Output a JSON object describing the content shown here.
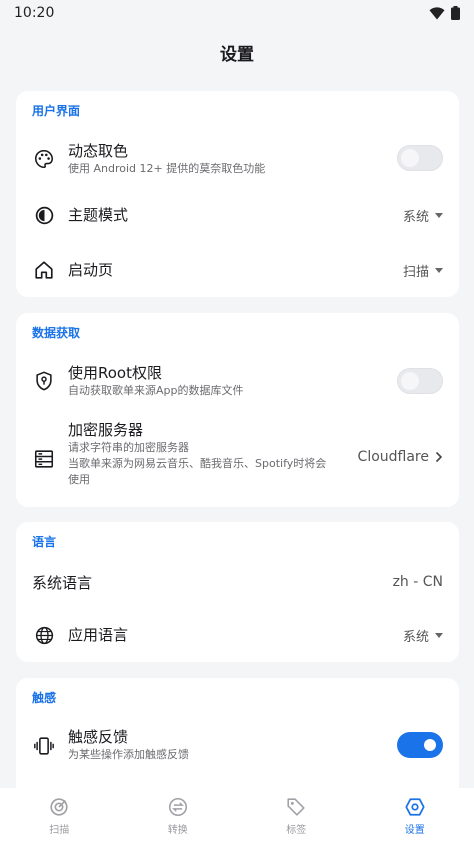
{
  "status_bar": {
    "time": "10:20"
  },
  "header": {
    "title": "设置"
  },
  "sections": {
    "ui": {
      "header": "用户界面",
      "dynamic_color": {
        "title": "动态取色",
        "subtitle": "使用 Android 12+ 提供的莫奈取色功能",
        "enabled": false
      },
      "theme_mode": {
        "title": "主题模式",
        "value": "系统"
      },
      "start_page": {
        "title": "启动页",
        "value": "扫描"
      }
    },
    "data": {
      "header": "数据获取",
      "root": {
        "title": "使用Root权限",
        "subtitle": "自动获取歌单来源App的数据库文件",
        "enabled": false
      },
      "encrypt_server": {
        "title": "加密服务器",
        "subtitle_1": "请求字符串的加密服务器",
        "subtitle_2": "当歌单来源为网易云音乐、酷我音乐、Spotify时将会",
        "subtitle_3": "使用",
        "value": "Cloudflare"
      }
    },
    "language": {
      "header": "语言",
      "system_language": {
        "title": "系统语言",
        "value": "zh - CN"
      },
      "app_language": {
        "title": "应用语言",
        "value": "系统"
      }
    },
    "haptics": {
      "header": "触感",
      "haptic_feedback": {
        "title": "触感反馈",
        "subtitle": "为某些操作添加触感反馈",
        "enabled": true
      }
    }
  },
  "bottom_nav": {
    "items": [
      {
        "label": "扫描",
        "icon": "scan-icon",
        "active": false
      },
      {
        "label": "转换",
        "icon": "convert-icon",
        "active": false
      },
      {
        "label": "标签",
        "icon": "tag-icon",
        "active": false
      },
      {
        "label": "设置",
        "icon": "settings-icon",
        "active": true
      }
    ]
  },
  "colors": {
    "accent": "#1a73e8",
    "background": "#f4f5f7",
    "card": "#ffffff"
  }
}
